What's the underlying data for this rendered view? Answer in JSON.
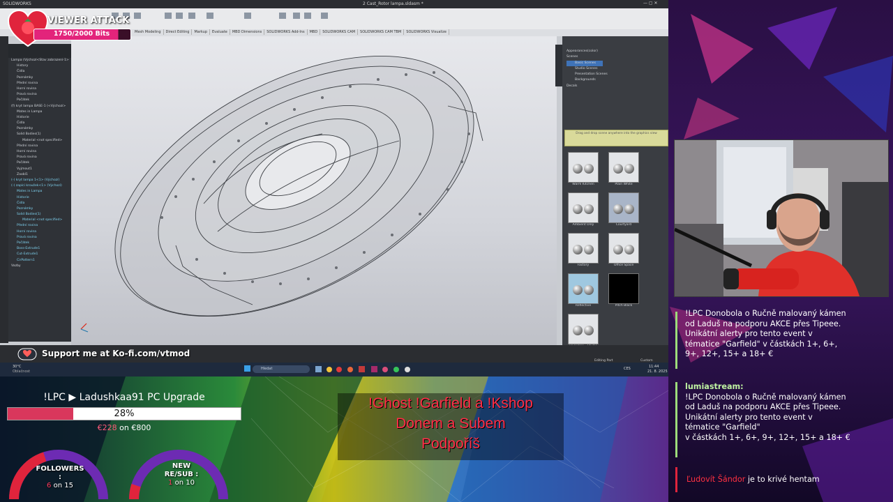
{
  "app": {
    "name": "SOLIDWORKS",
    "document_title": "2 Cast_Rotor lampa.sldasm *",
    "ribbon_tabs": [
      "Mesh Modeling",
      "Direct Editing",
      "Markup",
      "Evaluate",
      "MBD Dimensions",
      "SOLIDWORKS Add-Ins",
      "MBD",
      "SOLIDWORKS CAM",
      "SOLIDWORKS CAM TBM",
      "SOLIDWORKS Visualize"
    ],
    "feature_tree": [
      "Lampa (Výchozí<Stav zobrazení-1>",
      "History",
      "Čidla",
      "Poznámky",
      "Přední rovina",
      "Horní rovina",
      "Pravá rovina",
      "Počátek",
      "(f) kryt lampa BASE-1 (<Výchozí>",
      "Mates in Lampa",
      "Historie",
      "Čidla",
      "Poznámky",
      "Solid Bodies(1)",
      "Material <not specified>",
      "Přední rovina",
      "Horní rovina",
      "Pravá rovina",
      "Počátek",
      "Vyjmout1",
      "Zaobl1",
      "(-) kryt lampa 1<1> (Výchozí)",
      "(-) zapíci kroužek<1> (Výchozí)",
      "Mates in Lampa",
      "Historie",
      "Čidla",
      "Poznámky",
      "Solid Bodies(1)",
      "Material <not specified>",
      "Přední rovina",
      "Horní rovina",
      "Pravá rovina",
      "Počátek",
      "Boss-Extrude1",
      "Cut-Extrude1",
      "CirPattern1",
      "Vazby"
    ],
    "appearance_tree": [
      "Appearances(color)",
      "Scenes",
      "Basic Scenes",
      "Studio Scenes",
      "Presentation Scenes",
      "Backgrounds",
      "Decals"
    ],
    "drop_hint": "Drag and drop scene anywhere into the graphics view",
    "scenes": [
      {
        "label": "Warm Kitchen",
        "theme": "light"
      },
      {
        "label": "Plain White",
        "theme": "light"
      },
      {
        "label": "Ambient Only",
        "theme": "light"
      },
      {
        "label": "Courtyard",
        "theme": "blue"
      },
      {
        "label": "Factory",
        "theme": "light"
      },
      {
        "label": "Office Space",
        "theme": "light"
      },
      {
        "label": "Reflective",
        "theme": "cyan"
      },
      {
        "label": "Pitch Black",
        "theme": "black"
      },
      {
        "label": "Backdrop - Studio Room 2",
        "theme": "light"
      }
    ],
    "status_text": "Editing Part",
    "status_unit": "Custom"
  },
  "taskbar": {
    "weather_temp": "30°C",
    "weather_desc": "Oblačnost",
    "search_placeholder": "Hledat",
    "lang": "CES",
    "time": "11:44",
    "date": "21. 8. 2025"
  },
  "overlay": {
    "viewer_attack_title": "VIEWER ATTACK",
    "viewer_attack_bits": "1750/2000 Bits",
    "viewer_attack_progress": 0.875,
    "kofi_text": "Support me at Ko-fi.com/vtmod",
    "goal_title": "!LPC ▶ Ladushkaa91 PC Upgrade",
    "goal_percent": "28%",
    "goal_progress": 0.28,
    "goal_current": "€228",
    "goal_sep": " on ",
    "goal_target": "€800",
    "followers_label": "FOLLOWERS",
    "followers_colon": ":",
    "followers_value": "6",
    "followers_sep": " on ",
    "followers_target": "15",
    "followers_progress": 0.4,
    "resub_label_1": "NEW",
    "resub_label_2": "RE/SUB :",
    "resub_value": "1",
    "resub_sep": " on ",
    "resub_target": "10",
    "resub_progress": 0.1,
    "commands_lines": [
      "!Ghost  !Garfield a !Kshop",
      "Donem a Subem",
      "Podpoříš"
    ],
    "accent_red": "#e0243c",
    "accent_pink": "#e3247b"
  },
  "chat": [
    {
      "user": "",
      "lines": [
        "!LPC Donobola o Ručně malovaný kámen",
        "od Laduš na podporu AKCE přes Tipeee.",
        "Unikátní alerty pro tento event v",
        "tématice \"Garfield\" v částkách 1+, 6+,",
        "9+, 12+, 15+ a 18+ €"
      ]
    },
    {
      "user": "lumiastream:",
      "lines": [
        "!LPC Donobola o Ručně malovaný kámen",
        "od Laduš na podporu AKCE přes Tipeee.",
        "Unikátní alerty pro tento event v",
        "tématice \"Garfield\"",
        "v částkách 1+, 6+, 9+, 12+, 15+ a 18+ €"
      ]
    },
    {
      "user": "Ľudovít Šándor",
      "lines": [
        "je to krivé hentam"
      ]
    }
  ]
}
